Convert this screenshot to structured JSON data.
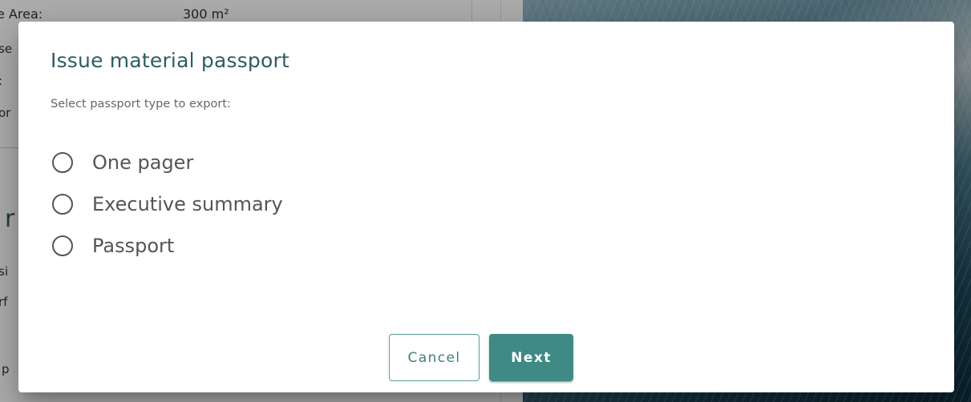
{
  "background": {
    "area_label": "e Area:",
    "area_value": "300 m²",
    "fragments": [
      "se",
      ":",
      "or",
      "si",
      "rf",
      "p"
    ],
    "heading_fragment": "r i"
  },
  "dialog": {
    "title": "Issue material passport",
    "subtitle": "Select passport type to export:",
    "options": [
      {
        "label": "One pager",
        "selected": false
      },
      {
        "label": "Executive summary",
        "selected": false
      },
      {
        "label": "Passport",
        "selected": false
      }
    ],
    "cancel_label": "Cancel",
    "next_label": "Next"
  },
  "colors": {
    "accent": "#3f8a85",
    "title": "#2e5d63"
  }
}
